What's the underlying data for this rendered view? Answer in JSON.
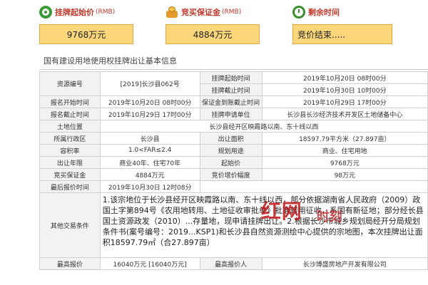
{
  "header": {
    "start_price": {
      "label": "挂牌起始价",
      "unit": "(RMB)",
      "value": "9768万元",
      "icon": "money-icon"
    },
    "deposit": {
      "label": "竞买保证金",
      "unit": "(RMB)",
      "value": "4884万元",
      "icon": "coins-icon"
    },
    "remaining": {
      "label": "剩余时间",
      "value": "竞价结束.....",
      "icon": "clock-icon"
    }
  },
  "section_title": "国有建设用地使用权挂牌出让基本信息",
  "table": {
    "r1": {
      "l1": "资源编号",
      "v1": "[2019]长沙县062号",
      "l2": "挂牌起始时间",
      "v2": "2019年10月20日 08时00分"
    },
    "r2": {
      "l2": "挂牌截止时间",
      "v2": "2019年10月30日 10时00分"
    },
    "r3": {
      "l1": "报名开始时间",
      "v1": "2019年10月20日 08时00分",
      "l2": "保证金到账截止时间",
      "v2": "2019年10月29日 17时00分"
    },
    "r4": {
      "l1": "报名截止时间",
      "v1": "2019年10月29日 17时00分",
      "l2": "挂牌申请单位",
      "v2": "长沙县长沙经济技术开发区土地储备中心"
    },
    "r5": {
      "l1": "土地位置",
      "v1": "长沙县经开区映霞路以南、东十线以西"
    },
    "r6": {
      "l1": "所属行政区",
      "v1": "长沙县",
      "l2": "出让面积",
      "v2": "18597.79平方米（27.897亩）"
    },
    "r7": {
      "l1": "容积率",
      "v1": "1.0<FAR≤2.4",
      "l2": "规划用途",
      "v2": "商业、住宅用地"
    },
    "r8": {
      "l1": "出让年限",
      "v1": "商业40年、住宅70年",
      "l2": "起始价",
      "v2": "9768万元"
    },
    "r9": {
      "l1": "竞买保证金",
      "v1": "4884万元",
      "l2": "竞价增价幅度",
      "v2": "98万元"
    },
    "r10": {
      "l1": "最后报价时间",
      "v1": "2019年10月30日 12时08分"
    },
    "r11": {
      "l1": "其他交易条件",
      "v1": "1.该宗地位于长沙县经开区映霞路以南、东十线以西，部分依据湖南省人民政府（2009）政国土字第894号《农用地转用、土地征收审批单》批准转用征收，系国有新征地；部分经长县国土资源政发（2010）...存量地，现申请挂牌出让。2.根据长沙市城乡规划局经开分局规划条件书(案号编号：2019...KSP1)和长沙县自然资源测绘中心提供的宗地图，本次挂牌出让面积18597.79㎡（合27.897亩）"
    },
    "r12": {
      "l1": "最高报价",
      "v1": "16040万元 [16040万元]",
      "l2": "最高报价人",
      "v2": "长沙博盛房地产开发有限公司"
    }
  },
  "watermark": {
    "main": "红网",
    "sub": "时刻"
  }
}
